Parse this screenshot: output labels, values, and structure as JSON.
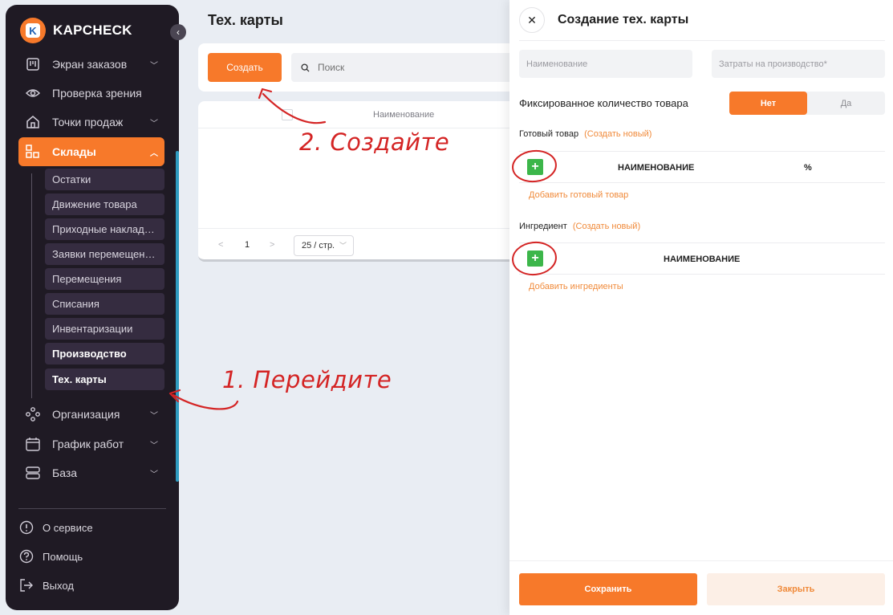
{
  "app": {
    "logo_letter": "K",
    "name": "KAPCHECK"
  },
  "sidebar": {
    "items": [
      {
        "label": "Экран заказов",
        "icon": "kanban-icon"
      },
      {
        "label": "Проверка зрения",
        "icon": "eye-icon"
      },
      {
        "label": "Точки продаж",
        "icon": "store-icon"
      },
      {
        "label": "Склады",
        "icon": "warehouse-icon",
        "active": true
      }
    ],
    "sub_items": [
      "Остатки",
      "Движение товара",
      "Приходные наклад…",
      "Заявки перемещен…",
      "Перемещения",
      "Списания",
      "Инвентаризации",
      "Производство",
      "Тех. карты"
    ],
    "items_after": [
      {
        "label": "Организация",
        "icon": "organization-icon"
      },
      {
        "label": "График работ",
        "icon": "calendar-icon"
      },
      {
        "label": "База",
        "icon": "database-icon"
      }
    ],
    "footer": [
      {
        "label": "О сервисе",
        "icon": "info-icon"
      },
      {
        "label": "Помощь",
        "icon": "help-icon"
      },
      {
        "label": "Выход",
        "icon": "logout-icon"
      }
    ]
  },
  "main": {
    "title": "Тех. карты",
    "create_label": "Создать",
    "search_placeholder": "Поиск",
    "table": {
      "col_name": "Наименование"
    },
    "pagination": {
      "prev": "<",
      "page": "1",
      "next": ">",
      "page_size": "25 / стр."
    }
  },
  "drawer": {
    "title": "Создание тех. карты",
    "close": "✕",
    "name_placeholder": "Наименование",
    "cost_placeholder": "Затраты на производство*",
    "fixed_label": "Фиксированное количество товара",
    "toggle_no": "Нет",
    "toggle_yes": "Да",
    "finished": {
      "label": "Готовый товар",
      "create_new": "(Создать новый)",
      "col_name": "НАИМЕНОВАНИЕ",
      "col_percent": "%",
      "add_link": "Добавить готовый товар"
    },
    "ingredient": {
      "label": "Ингредиент",
      "create_new": "(Создать новый)",
      "col_name": "НАИМЕНОВАНИЕ",
      "add_link": "Добавить ингредиенты"
    },
    "save_label": "Сохранить",
    "close_label": "Закрыть"
  },
  "annotations": {
    "step1": "1. Перейдите",
    "step2": "2. Создайте",
    "color": "#d42424"
  },
  "colors": {
    "accent": "#f7792a",
    "sidebar_bg": "#1f1a24",
    "plus_green": "#3cb64a"
  }
}
